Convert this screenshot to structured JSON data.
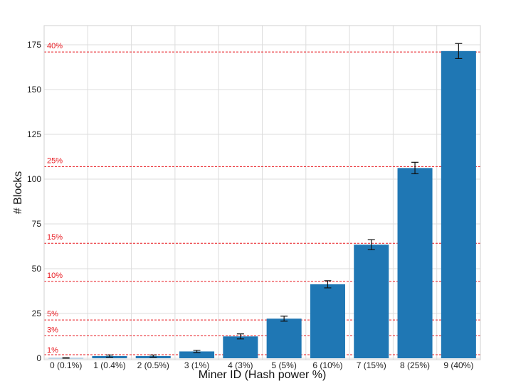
{
  "chart_data": {
    "type": "bar",
    "categories": [
      "0 (0.1%)",
      "1 (0.4%)",
      "2 (0.5%)",
      "3 (1%)",
      "4 (3%)",
      "5 (5%)",
      "6 (10%)",
      "7 (15%)",
      "8 (25%)",
      "9 (40%)"
    ],
    "values": [
      0.1,
      1.2,
      1.2,
      3.8,
      12.2,
      22.1,
      41.3,
      63.4,
      106.2,
      171.5
    ],
    "errors": [
      0.2,
      0.6,
      0.6,
      0.6,
      1.4,
      1.4,
      2.0,
      2.8,
      3.2,
      4.2
    ],
    "xlabel": "Miner ID (Hash power %)",
    "ylabel": "# Blocks",
    "ylim": [
      0,
      185
    ],
    "yticks": [
      0,
      25,
      50,
      75,
      100,
      125,
      150,
      175
    ],
    "grid": true,
    "bar_color": "#1f77b4",
    "reference_lines": [
      {
        "label": "1%",
        "value": 2.0,
        "label_value": 3.2
      },
      {
        "label": "3%",
        "value": 12.5,
        "label_value": 14.5
      },
      {
        "label": "5%",
        "value": 21.4,
        "label_value": 23.4
      },
      {
        "label": "10%",
        "value": 42.9,
        "label_value": 44.9
      },
      {
        "label": "15%",
        "value": 64.2,
        "label_value": 66.2
      },
      {
        "label": "25%",
        "value": 107.0,
        "label_value": 109.0
      },
      {
        "label": "40%",
        "value": 171.0,
        "label_value": 173.0
      }
    ],
    "reference_line_color": "#e8181f"
  }
}
